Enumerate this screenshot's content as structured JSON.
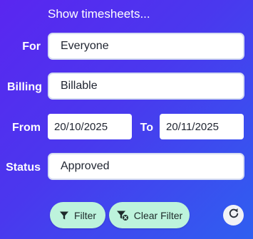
{
  "header": {
    "title": "Show timesheets..."
  },
  "form": {
    "for_label": "For",
    "for_value": "Everyone",
    "billing_label": "Billing",
    "billing_value": "Billable",
    "from_label": "From",
    "from_value": "20/10/2025",
    "to_label": "To",
    "to_value": "20/11/2025",
    "status_label": "Status",
    "status_value": "Approved"
  },
  "actions": {
    "filter_label": "Filter",
    "filter_icon": "funnel-icon",
    "clear_label": "Clear Filter",
    "clear_icon": "funnel-clear-icon",
    "refresh_icon": "refresh-icon"
  },
  "colors": {
    "background_start": "#5a26f0",
    "background_end": "#2f5ff0",
    "button_bg": "#bdf3dc",
    "field_bg": "#ffffff"
  }
}
